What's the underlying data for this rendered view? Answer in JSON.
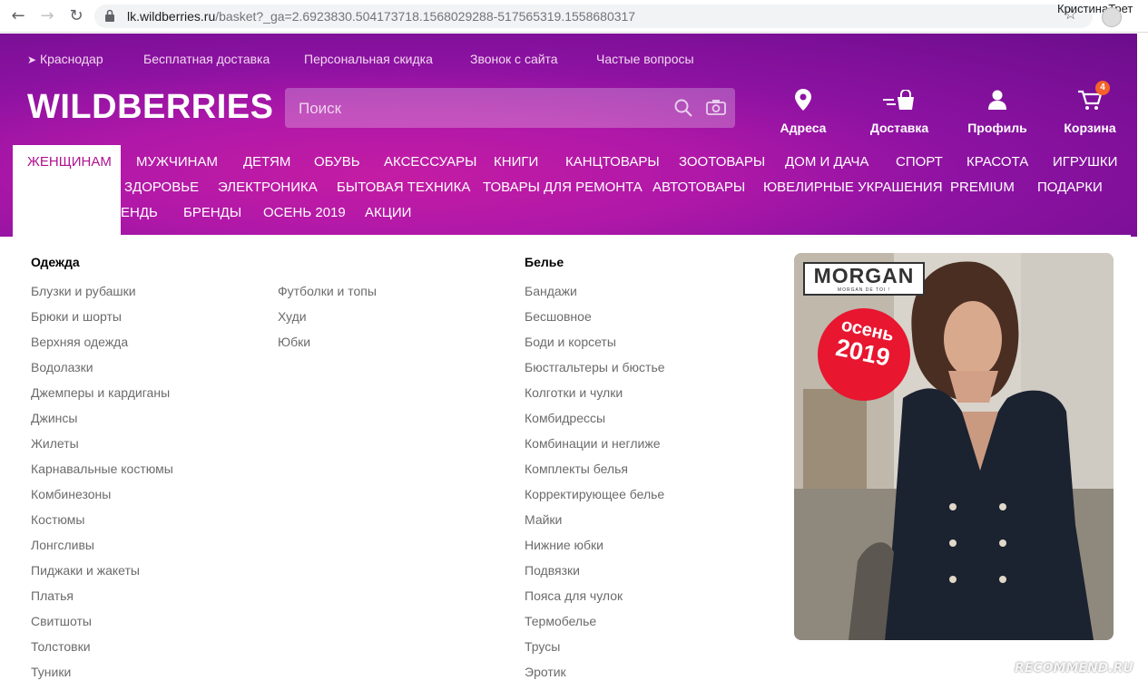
{
  "browser": {
    "url_host": "lk.wildberries.ru",
    "url_path": "/basket?_ga=2.6923830.504173718.1568029288-517565319.1558680317",
    "user_name": "КристинаТрет"
  },
  "header": {
    "util_links": [
      "Краснодар",
      "Бесплатная доставка",
      "Персональная скидка",
      "Звонок с сайта",
      "Частые вопросы"
    ],
    "logo": "WILDBERRIES",
    "search_placeholder": "Поиск",
    "actions": {
      "addresses": "Адреса",
      "delivery": "Доставка",
      "profile": "Профиль",
      "cart": "Корзина",
      "cart_count": "4"
    }
  },
  "categories": {
    "row1": [
      "ЖЕНЩИНАМ",
      "МУЖЧИНАМ",
      "ДЕТЯМ",
      "ОБУВЬ",
      "АКСЕССУАРЫ",
      "КНИГИ",
      "КАНЦТОВАРЫ",
      "ЗООТОВАРЫ",
      "ДОМ И ДАЧА",
      "СПОРТ",
      "КРАСОТА",
      "ИГРУШКИ"
    ],
    "row2": [
      "ЗДОРОВЬЕ",
      "ЭЛЕКТРОНИКА",
      "БЫТОВАЯ ТЕХНИКА",
      "ТОВАРЫ ДЛЯ РЕМОНТА",
      "АВТОТОВАРЫ",
      "ЮВЕЛИРНЫЕ УКРАШЕНИЯ",
      "PREMIUM",
      "ПОДАРКИ"
    ],
    "row3": [
      "ЕНДЫ",
      "БРЕНДЫ",
      "ОСЕНЬ 2019",
      "АКЦИИ"
    ]
  },
  "dropdown": {
    "clothing_title": "Одежда",
    "clothing_col1": [
      "Блузки и рубашки",
      "Брюки и шорты",
      "Верхняя одежда",
      "Водолазки",
      "Джемперы и кардиганы",
      "Джинсы",
      "Жилеты",
      "Карнавальные костюмы",
      "Комбинезоны",
      "Костюмы",
      "Лонгсливы",
      "Пиджаки и жакеты",
      "Платья",
      "Свитшоты",
      "Толстовки",
      "Туники"
    ],
    "clothing_col2": [
      "Футболки и топы",
      "Худи",
      "Юбки"
    ],
    "lingerie_title": "Белье",
    "lingerie": [
      "Бандажи",
      "Бесшовное",
      "Боди и корсеты",
      "Бюстгальтеры и бюстье",
      "Колготки и чулки",
      "Комбидрессы",
      "Комбинации и неглиже",
      "Комплекты белья",
      "Корректирующее белье",
      "Майки",
      "Нижние юбки",
      "Подвязки",
      "Пояса для чулок",
      "Термобелье",
      "Трусы",
      "Эротик"
    ]
  },
  "promo": {
    "brand": "MORGAN",
    "brand_tagline": "MORGAN DE TOI !",
    "badge_line1": "осень",
    "badge_line2": "2019"
  },
  "watermark": "RECOMMEND.RU",
  "colors": {
    "accent": "#b0118f",
    "header_start": "#c41ca4",
    "header_end": "#6b0d8c",
    "badge": "#f5612c"
  }
}
